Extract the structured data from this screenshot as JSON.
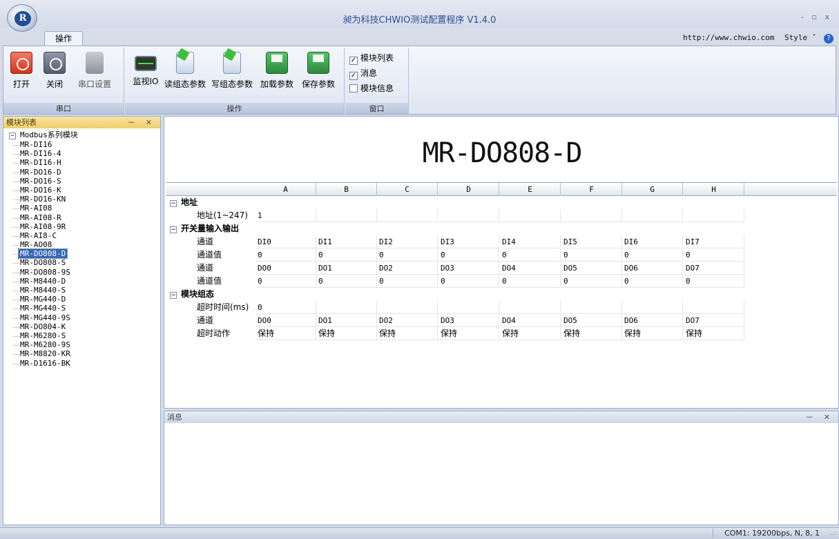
{
  "window": {
    "title": "昶为科技CHWIO测试配置程序 V1.4.0",
    "controls": "- ▫ x",
    "logo_text": "R"
  },
  "ribbon": {
    "tab": "操作",
    "url": "http://www.chwio.com",
    "style_label": "Style ˇ",
    "help": "?",
    "groups": {
      "serial": {
        "label": "串口",
        "open": "打开",
        "close": "关闭",
        "port_settings": "串口设置"
      },
      "ops": {
        "label": "操作",
        "monitor": "监视IO",
        "read": "读组态参数",
        "write": "写组态参数",
        "load": "加载参数",
        "save": "保存参数"
      },
      "window": {
        "label": "窗口",
        "items": [
          {
            "label": "模块列表",
            "checked": "✓"
          },
          {
            "label": "消息",
            "checked": "✓"
          },
          {
            "label": "模块信息",
            "checked": ""
          }
        ]
      }
    }
  },
  "module_list": {
    "title": "模块列表",
    "pin": "ᅮ ✕",
    "root_expander": "−",
    "root": "Modbus系列模块",
    "items": [
      "MR-DI16",
      "MR-DI16-4",
      "MR-DI16-H",
      "MR-DO16-D",
      "MR-DO16-S",
      "MR-DO16-K",
      "MR-DO16-KN",
      "MR-AI08",
      "MR-AI08-R",
      "MR-AI08-9R",
      "MR-AI8-C",
      "MR-AO08",
      "MR-DO808-D",
      "MR-DO808-S",
      "MR-DO808-9S",
      "MR-M8440-D",
      "MR-M8440-S",
      "MR-MG440-D",
      "MR-MG440-S",
      "MR-MG440-9S",
      "MR-DO804-K",
      "MR-M6280-S",
      "MR-M6280-9S",
      "MR-M8820-KR",
      "MR-D1616-BK"
    ],
    "selected": "MR-DO808-D"
  },
  "main": {
    "module_title": "MR-DO808-D",
    "columns": [
      "A",
      "B",
      "C",
      "D",
      "E",
      "F",
      "G",
      "H"
    ],
    "expander": "−",
    "categories": [
      {
        "name": "地址",
        "rows": [
          {
            "label": "地址(1~247)",
            "values": [
              "1"
            ]
          }
        ]
      },
      {
        "name": "开关量输入输出",
        "rows": [
          {
            "label": "通道",
            "values": [
              "DI0",
              "DI1",
              "DI2",
              "DI3",
              "DI4",
              "DI5",
              "DI6",
              "DI7"
            ]
          },
          {
            "label": "通道值",
            "values": [
              "0",
              "0",
              "0",
              "0",
              "0",
              "0",
              "0",
              "0"
            ]
          },
          {
            "label": "通道",
            "values": [
              "DO0",
              "DO1",
              "DO2",
              "DO3",
              "DO4",
              "DO5",
              "DO6",
              "DO7"
            ]
          },
          {
            "label": "通道值",
            "values": [
              "0",
              "0",
              "0",
              "0",
              "0",
              "0",
              "0",
              "0"
            ]
          }
        ]
      },
      {
        "name": "模块组态",
        "rows": [
          {
            "label": "超时时间(ms)",
            "values": [
              "0"
            ]
          },
          {
            "label": "通道",
            "values": [
              "DO0",
              "DO1",
              "DO2",
              "DO3",
              "DO4",
              "DO5",
              "DO6",
              "DO7"
            ]
          },
          {
            "label": "超时动作",
            "values": [
              "保持",
              "保持",
              "保持",
              "保持",
              "保持",
              "保持",
              "保持",
              "保持"
            ]
          }
        ]
      }
    ]
  },
  "messages": {
    "title": "消息",
    "pin": "ᅮ ✕"
  },
  "status": {
    "connection": "COM1: 19200bps, N, 8, 1",
    "grip": "..:"
  }
}
